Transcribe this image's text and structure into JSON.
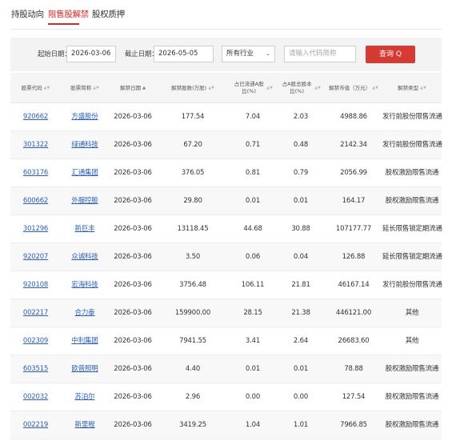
{
  "tabs": [
    {
      "label": "持股动向",
      "active": false
    },
    {
      "label": "限售股解禁",
      "active": true
    },
    {
      "label": "股权质押",
      "active": false
    }
  ],
  "filter": {
    "start_label": "起始日期：",
    "start_value": "2026-03-06",
    "end_label": "截止日期：",
    "end_value": "2026-05-05",
    "industry_value": "所有行业",
    "search_placeholder": "请输入代码简称",
    "query_label": "查询 Q"
  },
  "table": {
    "headers": [
      {
        "label": "股票代码",
        "sort": "none"
      },
      {
        "label": "股票简称",
        "sort": "none"
      },
      {
        "label": "解禁日期",
        "sort": "asc"
      },
      {
        "label": "解禁股数(万股)",
        "sort": "none"
      },
      {
        "label": "占已流通A股比(%)",
        "sort": "none"
      },
      {
        "label": "占A股总股本比(%)",
        "sort": "none"
      },
      {
        "label": "解禁市值（万元）",
        "sort": "none"
      },
      {
        "label": "解禁类型",
        "sort": "none"
      }
    ],
    "rows": [
      [
        "920662",
        "方盛股份",
        "2026-03-06",
        "177.54",
        "7.04",
        "2.03",
        "4988.86",
        "发行前股份限售流通"
      ],
      [
        "301322",
        "绿通科技",
        "2026-03-06",
        "67.20",
        "0.71",
        "0.48",
        "2142.34",
        "发行前股份限售流通"
      ],
      [
        "603176",
        "汇通集团",
        "2026-03-06",
        "376.05",
        "0.81",
        "0.79",
        "2056.99",
        "股权激励限售流通"
      ],
      [
        "600662",
        "外服控股",
        "2026-03-06",
        "29.80",
        "0.01",
        "0.01",
        "164.17",
        "股权激励限售流通"
      ],
      [
        "301296",
        "新巨丰",
        "2026-03-06",
        "13118.45",
        "44.68",
        "30.88",
        "107177.77",
        "延长限售锁定期流通"
      ],
      [
        "920207",
        "众诚科技",
        "2026-03-06",
        "3.50",
        "0.06",
        "0.04",
        "126.88",
        "延长限售锁定期流通"
      ],
      [
        "920108",
        "宏海科技",
        "2026-03-06",
        "3756.48",
        "106.11",
        "21.81",
        "46167.14",
        "发行前股份限售流通"
      ],
      [
        "002217",
        "合力泰",
        "2026-03-06",
        "159900.00",
        "28.15",
        "21.38",
        "446121.00",
        "其他"
      ],
      [
        "002309",
        "中利集团",
        "2026-03-06",
        "7941.55",
        "3.41",
        "2.64",
        "26683.60",
        "其他"
      ],
      [
        "603515",
        "欧普照明",
        "2026-03-06",
        "4.40",
        "0.01",
        "0.01",
        "78.88",
        "股权激励限售流通"
      ],
      [
        "002032",
        "苏泊尔",
        "2026-03-06",
        "2.96",
        "0.00",
        "0.00",
        "127.54",
        "股权激励限售流通"
      ],
      [
        "002219",
        "新里程",
        "2026-03-06",
        "3419.25",
        "1.04",
        "1.01",
        "7966.85",
        "股权激励限售流通"
      ]
    ]
  }
}
